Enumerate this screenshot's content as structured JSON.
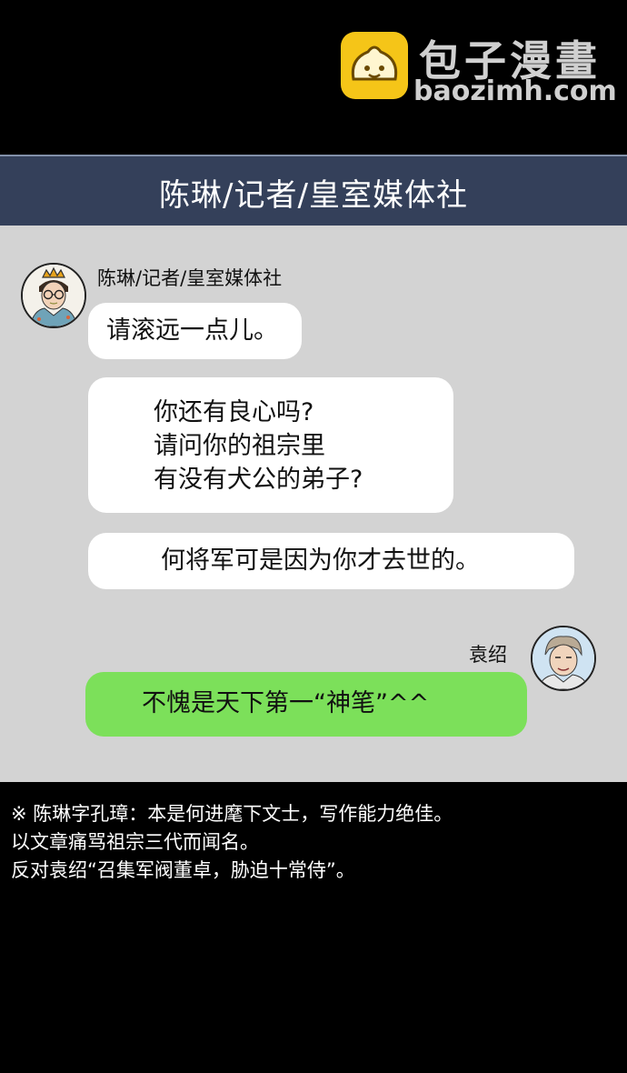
{
  "watermark": {
    "title": "包子漫畫",
    "url": "baozimh.com"
  },
  "header": {
    "title": "陈琳/记者/皇室媒体社"
  },
  "chat": {
    "sender1": {
      "name": "陈琳/记者/皇室媒体社",
      "avatar_icon": "man-with-glasses-crown-avatar",
      "messages": [
        "请滚远一点儿。",
        "你还有良心吗?\n请问你的祖宗里\n有没有犬公的弟子?",
        "何将军可是因为你才去世的。"
      ]
    },
    "sender2": {
      "name": "袁绍",
      "avatar_icon": "man-portrait-avatar",
      "messages": [
        "不愧是天下第一“神笔”^^"
      ]
    }
  },
  "footnote": {
    "lines": [
      "※ 陈琳字孔璋：本是何进麾下文士，写作能力绝佳。",
      "以文章痛骂祖宗三代而闻名。",
      "反对袁绍“召集军阀董卓，胁迫十常侍”。"
    ]
  },
  "colors": {
    "background": "#000000",
    "header_bar": "#34405a",
    "chat_panel": "#d3d3d3",
    "incoming_bubble": "#ffffff",
    "outgoing_bubble": "#7ce05a",
    "logo": "#f5c518"
  }
}
